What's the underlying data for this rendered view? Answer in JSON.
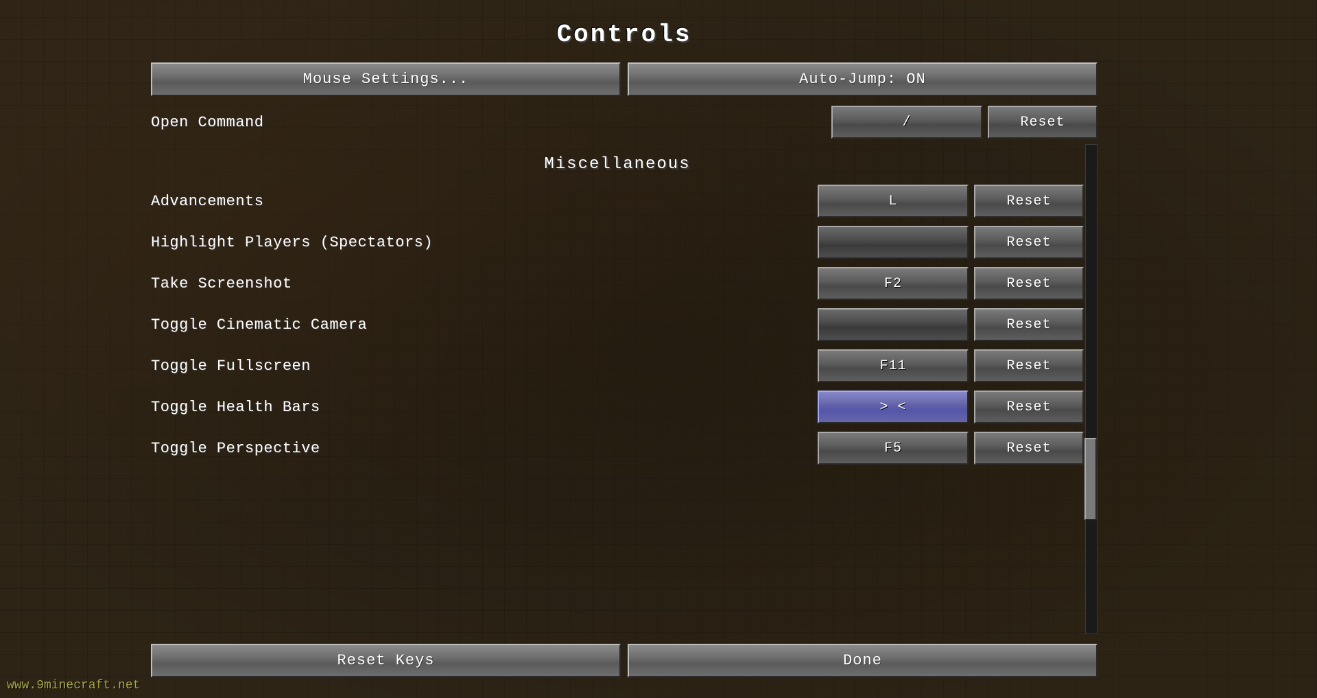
{
  "page": {
    "title": "Controls",
    "watermark": "www.9minecraft.net"
  },
  "top_buttons": {
    "mouse_settings": "Mouse Settings...",
    "auto_jump": "Auto-Jump: ON"
  },
  "open_command": {
    "label": "Open Command",
    "key": "/",
    "reset": "Reset"
  },
  "sections": [
    {
      "title": "Miscellaneous",
      "rows": [
        {
          "label": "Advancements",
          "key": "L",
          "key_state": "normal",
          "reset": "Reset"
        },
        {
          "label": "Highlight Players (Spectators)",
          "key": "",
          "key_state": "empty",
          "reset": "Reset"
        },
        {
          "label": "Take Screenshot",
          "key": "F2",
          "key_state": "normal",
          "reset": "Reset"
        },
        {
          "label": "Toggle Cinematic Camera",
          "key": "",
          "key_state": "empty",
          "reset": "Reset"
        },
        {
          "label": "Toggle Fullscreen",
          "key": "F11",
          "key_state": "normal",
          "reset": "Reset"
        },
        {
          "label": "Toggle Health Bars",
          "key": "> <",
          "key_state": "active",
          "reset": "Reset"
        },
        {
          "label": "Toggle Perspective",
          "key": "F5",
          "key_state": "normal",
          "reset": "Reset"
        }
      ]
    }
  ],
  "bottom_buttons": {
    "reset_keys": "Reset Keys",
    "done": "Done"
  }
}
